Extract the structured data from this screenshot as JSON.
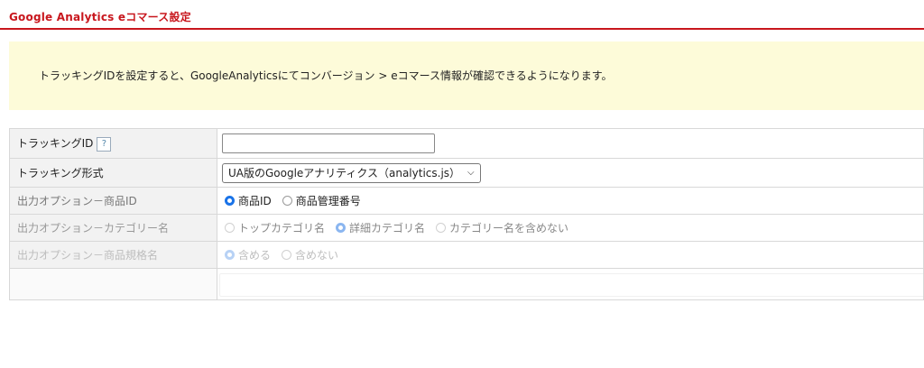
{
  "header": {
    "title": "Google Analytics eコマース設定"
  },
  "notice": {
    "text": "トラッキングIDを設定すると、GoogleAnalyticsにてコンバージョン > eコマース情報が確認できるようになります。"
  },
  "rows": {
    "tracking_id": {
      "label": "トラッキングID",
      "help": "?",
      "value": ""
    },
    "tracking_format": {
      "label": "トラッキング形式",
      "selected": "UA版のGoogleアナリティクス（analytics.js）"
    },
    "product_id_option": {
      "label": "出力オプション－商品ID",
      "options": [
        "商品ID",
        "商品管理番号"
      ],
      "selected_index": 0
    },
    "category_option": {
      "label": "出力オプション－カテゴリー名",
      "options": [
        "トップカテゴリ名",
        "詳細カテゴリ名",
        "カテゴリー名を含めない"
      ],
      "selected_index": 1
    },
    "spec_option": {
      "label": "出力オプション－商品規格名",
      "options": [
        "含める",
        "含めない"
      ],
      "selected_index": 0
    }
  },
  "colors": {
    "accent": "#c8161d",
    "notice_bg": "#fdfbd9",
    "radio_on": "#1a73e8"
  }
}
